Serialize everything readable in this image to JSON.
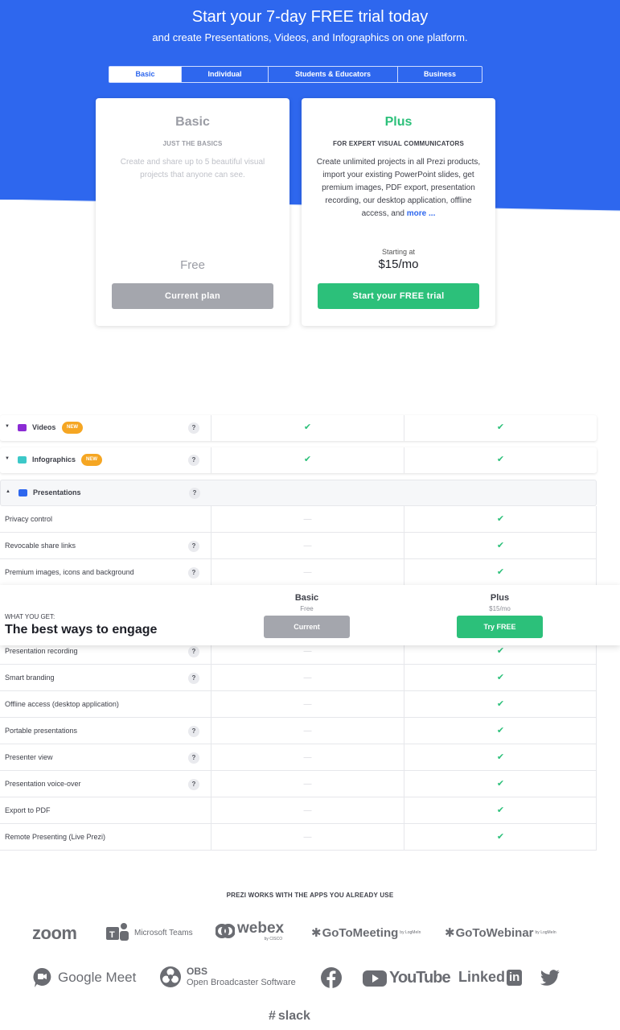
{
  "hero": {
    "title": "Start your 7-day FREE trial today",
    "subtitle": "and create Presentations, Videos, and Infographics on one platform."
  },
  "tabs": [
    {
      "label": "Basic",
      "active": true
    },
    {
      "label": "Individual",
      "active": false
    },
    {
      "label": "Students & Educators",
      "active": false
    },
    {
      "label": "Business",
      "active": false
    }
  ],
  "plans": {
    "basic": {
      "name": "Basic",
      "tagline": "JUST THE BASICS",
      "description": "Create and share up to 5 beautiful visual projects that anyone can see.",
      "price": "Free",
      "button": "Current plan"
    },
    "plus": {
      "name": "Plus",
      "tagline": "FOR EXPERT VISUAL COMMUNICATORS",
      "description": "Create unlimited projects in all Prezi products, import your existing PowerPoint slides, get premium images, PDF export, presentation recording, our desktop application, offline access, and",
      "more_link": "more ...",
      "starting_at": "Starting at",
      "price": "$15/mo",
      "button": "Start your FREE trial"
    }
  },
  "features": {
    "categories": [
      {
        "name": "Videos",
        "badge": "NEW",
        "basic": true,
        "plus": true
      },
      {
        "name": "Infographics",
        "badge": "NEW",
        "basic": true,
        "plus": true
      },
      {
        "name": "Presentations",
        "badge": "",
        "basic": null,
        "plus": null
      }
    ],
    "rows": [
      {
        "label": "Privacy control",
        "help": false,
        "basic": false,
        "plus": true
      },
      {
        "label": "Revocable share links",
        "help": true,
        "basic": false,
        "plus": true
      },
      {
        "label": "Premium images, icons and background",
        "help": true,
        "basic": false,
        "plus": true
      },
      {
        "label": "Presentation recording",
        "help": true,
        "basic": false,
        "plus": true
      },
      {
        "label": "Smart branding",
        "help": true,
        "basic": false,
        "plus": true
      },
      {
        "label": "Offline access (desktop application)",
        "help": false,
        "basic": false,
        "plus": true
      },
      {
        "label": "Portable presentations",
        "help": true,
        "basic": false,
        "plus": true
      },
      {
        "label": "Presenter view",
        "help": true,
        "basic": false,
        "plus": true
      },
      {
        "label": "Presentation voice-over",
        "help": true,
        "basic": false,
        "plus": true
      },
      {
        "label": "Export to PDF",
        "help": false,
        "basic": false,
        "plus": true
      },
      {
        "label": "Remote Presenting (Live Prezi)",
        "help": false,
        "basic": false,
        "plus": true
      }
    ]
  },
  "sticky_header": {
    "what_you_get": "WHAT YOU GET:",
    "headline": "The best ways to engage",
    "basic": {
      "name": "Basic",
      "price": "Free",
      "button": "Current"
    },
    "plus": {
      "name": "Plus",
      "price": "$15/mo",
      "button": "Try FREE"
    }
  },
  "apps": {
    "title": "PREZI WORKS WITH THE APPS YOU ALREADY USE",
    "logos": {
      "zoom": "zoom",
      "teams": "Microsoft Teams",
      "webex": "webex",
      "webex_by": "by CISCO",
      "gotomeeting": "GoToMeeting",
      "gotowebinar": "GoToWebinar",
      "logmein": "by LogMeIn",
      "googlemeet": "Google Meet",
      "obs": "OBS",
      "obs_full": "Open Broadcaster Software",
      "youtube": "YouTube",
      "linkedin": "Linked",
      "linkedin_in": "in",
      "slack": "slack"
    }
  },
  "colors": {
    "hero_blue": "#2e67ee",
    "green": "#2cc07a",
    "gray_button": "#a4a6ad",
    "new_badge": "#f5a623"
  },
  "check_glyph": "✔",
  "dash_glyph": "—",
  "help_glyph": "?"
}
